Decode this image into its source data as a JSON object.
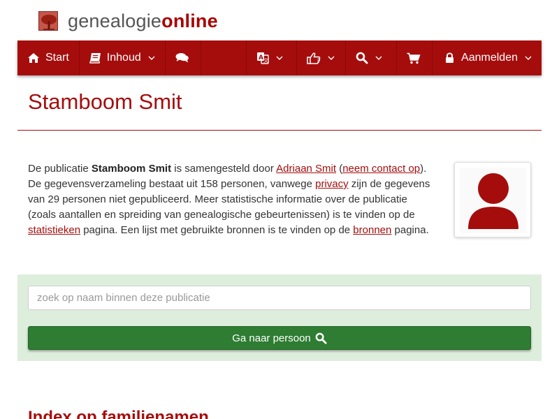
{
  "logo": {
    "text_part1": "genealogie",
    "text_part2": "online",
    "icon": "tree-logo-icon"
  },
  "nav": {
    "start_label": "Start",
    "inhoud_label": "Inhoud",
    "login_label": "Aanmelden",
    "icons": [
      "home-icon",
      "book-icon",
      "comments-icon",
      "language-icon",
      "thumbs-up-icon",
      "search-icon",
      "cart-icon",
      "lock-icon"
    ]
  },
  "page": {
    "title": "Stamboom Smit"
  },
  "intro": {
    "t1": "De publicatie ",
    "pub_name": "Stamboom Smit",
    "t2": " is samengesteld door ",
    "author_link": "Adriaan Smit",
    "t3": " (",
    "contact_link": "neem contact op",
    "t4": "). De gegevensverzameling bestaat uit 158 personen, vanwege ",
    "privacy_link": "privacy",
    "t5": " zijn de gegevens van 29 personen niet gepubliceerd. Meer statistische informatie over de publicatie (zoals aantallen en spreiding van genealogische gebeurtenissen) is te vinden op de ",
    "stats_link": "statistieken",
    "t6": " pagina. Een lijst met gebruikte bronnen is te vinden op de ",
    "sources_link": "bronnen",
    "t7": " pagina."
  },
  "search": {
    "placeholder": "zoek op naam binnen deze publicatie",
    "value": "",
    "button_label": "Ga naar persoon"
  },
  "section": {
    "title": "Index op familienamen"
  },
  "colors": {
    "brand": "#a50d0d",
    "panel": "#deeedd",
    "button": "#2e7d32"
  }
}
